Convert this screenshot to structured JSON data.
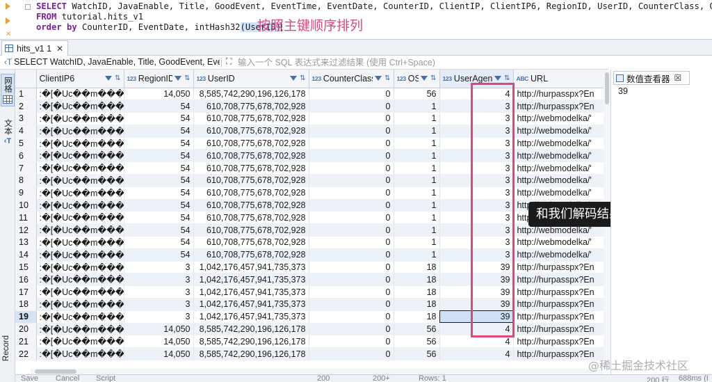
{
  "editor": {
    "line1_kw": "SELECT",
    "line1_rest": " WatchID, JavaEnable, Title, GoodEvent, EventTime, EventDate, CounterID, ClientIP, ClientIP6, RegionID, UserID, CounterClass, OS, UserAgent, URL,",
    "line2_kw": "FROM",
    "line2_rest": " tutorial.hits_v1",
    "line3_kw": "order by",
    "line3_rest": " CounterID, EventDate, intHash32",
    "line3_paren": "(UserID)",
    "annotation": "按照主键顺序排列"
  },
  "results_tab": {
    "label": "hits_v1 1"
  },
  "filter_bar": {
    "sql_text": "SELECT WatchID, JavaEnable, Title, GoodEvent, EventT",
    "placeholder": "输入一个 SQL 表达式来过滤结果 (使用 Ctrl+Space)"
  },
  "left_toolbar": {
    "grid_label": "网格",
    "text_label": "文本",
    "record_label": "Record"
  },
  "columns": [
    {
      "name": "ClientIP6",
      "type": ""
    },
    {
      "name": "RegionID",
      "type": "123"
    },
    {
      "name": "UserID",
      "type": "123"
    },
    {
      "name": "CounterClass",
      "type": "123"
    },
    {
      "name": "OS",
      "type": "123"
    },
    {
      "name": "UserAgent",
      "type": "123"
    },
    {
      "name": "URL",
      "type": "ABC"
    }
  ],
  "rows": [
    {
      "n": "1",
      "ip6": ":�[�Uc��m���",
      "region": "14,050",
      "user": "8,585,742,290,196,126,178",
      "cc": "0",
      "os": "56",
      "ua": "4",
      "url": "http://hurpasspx?En"
    },
    {
      "n": "2",
      "ip6": ":�[�Uc��m���",
      "region": "54",
      "user": "610,708,775,678,702,928",
      "cc": "0",
      "os": "1",
      "ua": "3",
      "url": "http://hurpasspx?En"
    },
    {
      "n": "3",
      "ip6": ":�[�Uc��m���",
      "region": "54",
      "user": "610,708,775,678,702,928",
      "cc": "0",
      "os": "1",
      "ua": "3",
      "url": "http://webmodelka/'"
    },
    {
      "n": "4",
      "ip6": ":�[�Uc��m���",
      "region": "54",
      "user": "610,708,775,678,702,928",
      "cc": "0",
      "os": "1",
      "ua": "3",
      "url": "http://webmodelka/'"
    },
    {
      "n": "5",
      "ip6": ":�[�Uc��m���",
      "region": "54",
      "user": "610,708,775,678,702,928",
      "cc": "0",
      "os": "1",
      "ua": "3",
      "url": "http://webmodelka/'"
    },
    {
      "n": "6",
      "ip6": ":�[�Uc��m���",
      "region": "54",
      "user": "610,708,775,678,702,928",
      "cc": "0",
      "os": "1",
      "ua": "3",
      "url": "http://webmodelka/'"
    },
    {
      "n": "7",
      "ip6": ":�[�Uc��m���",
      "region": "54",
      "user": "610,708,775,678,702,928",
      "cc": "0",
      "os": "1",
      "ua": "3",
      "url": "http://webmodelka/'"
    },
    {
      "n": "8",
      "ip6": ":�[�Uc��m���",
      "region": "54",
      "user": "610,708,775,678,702,928",
      "cc": "0",
      "os": "1",
      "ua": "3",
      "url": "http://webmodelka/'"
    },
    {
      "n": "9",
      "ip6": ":�[�Uc��m���",
      "region": "54",
      "user": "610,708,775,678,702,928",
      "cc": "0",
      "os": "1",
      "ua": "3",
      "url": "http://webmodelka/'"
    },
    {
      "n": "10",
      "ip6": ":�[�Uc��m���",
      "region": "54",
      "user": "610,708,775,678,702,928",
      "cc": "0",
      "os": "1",
      "ua": "3",
      "url": "http://webmodelka/'"
    },
    {
      "n": "11",
      "ip6": ":�[�Uc��m���",
      "region": "54",
      "user": "610,708,775,678,702,928",
      "cc": "0",
      "os": "1",
      "ua": "3",
      "url": "http://webmodelka/'"
    },
    {
      "n": "12",
      "ip6": ":�[�Uc��m���",
      "region": "54",
      "user": "610,708,775,678,702,928",
      "cc": "0",
      "os": "1",
      "ua": "3",
      "url": "http://webmodelka/'"
    },
    {
      "n": "13",
      "ip6": ":�[�Uc��m���",
      "region": "54",
      "user": "610,708,775,678,702,928",
      "cc": "0",
      "os": "1",
      "ua": "3",
      "url": "http://webmodelka/'"
    },
    {
      "n": "14",
      "ip6": ":�[�Uc��m���",
      "region": "54",
      "user": "610,708,775,678,702,928",
      "cc": "0",
      "os": "1",
      "ua": "3",
      "url": "http://webmodelka/'"
    },
    {
      "n": "15",
      "ip6": ":�[�Uc��m���",
      "region": "3",
      "user": "1,042,176,457,941,735,373",
      "cc": "0",
      "os": "18",
      "ua": "39",
      "url": "http://hurpasspx?En"
    },
    {
      "n": "16",
      "ip6": ":�[�Uc��m���",
      "region": "3",
      "user": "1,042,176,457,941,735,373",
      "cc": "0",
      "os": "18",
      "ua": "39",
      "url": "http://hurpasspx?En"
    },
    {
      "n": "17",
      "ip6": ":�[�Uc��m���",
      "region": "3",
      "user": "1,042,176,457,941,735,373",
      "cc": "0",
      "os": "18",
      "ua": "39",
      "url": "http://hurpasspx?En"
    },
    {
      "n": "18",
      "ip6": ":�[�Uc��m���",
      "region": "3",
      "user": "1,042,176,457,941,735,373",
      "cc": "0",
      "os": "18",
      "ua": "39",
      "url": "http://hurpasspx?En"
    },
    {
      "n": "19",
      "ip6": ":�[�Uc��m���",
      "region": "3",
      "user": "1,042,176,457,941,735,373",
      "cc": "0",
      "os": "18",
      "ua": "39",
      "url": "http://hurpasspx?En"
    },
    {
      "n": "20",
      "ip6": ":�[�Uc��m���",
      "region": "14,050",
      "user": "8,585,742,290,196,126,178",
      "cc": "0",
      "os": "56",
      "ua": "4",
      "url": "http://hurpasspx?En"
    },
    {
      "n": "21",
      "ip6": ":�[�Uc��m���",
      "region": "14,050",
      "user": "8,585,742,290,196,126,178",
      "cc": "0",
      "os": "56",
      "ua": "4",
      "url": "http://hurpasspx?En"
    },
    {
      "n": "22",
      "ip6": ":�[�Uc��m���",
      "region": "14,050",
      "user": "8,585,742,290,196,126,178",
      "cc": "0",
      "os": "56",
      "ua": "4",
      "url": "http://hurpasspx?En"
    }
  ],
  "selected_row": "19",
  "callout": "和我们解码结果一模一样",
  "value_panel": {
    "title": "数值查看器",
    "value": "39"
  },
  "bottom_bar": {
    "save": "Save",
    "cancel": "Cancel",
    "script": "Script",
    "fetch": "200",
    "fetch_all": "200+",
    "rows": "Rows: 1",
    "row_count": "200 行",
    "time": "688ms (Ï"
  },
  "watermark": "@稀土掘金技术社区",
  "colors": {
    "keyword": "#7b1fa2",
    "annotation": "#e0457b",
    "accent": "#3f6fb1",
    "alt_row": "#edf1f8"
  }
}
